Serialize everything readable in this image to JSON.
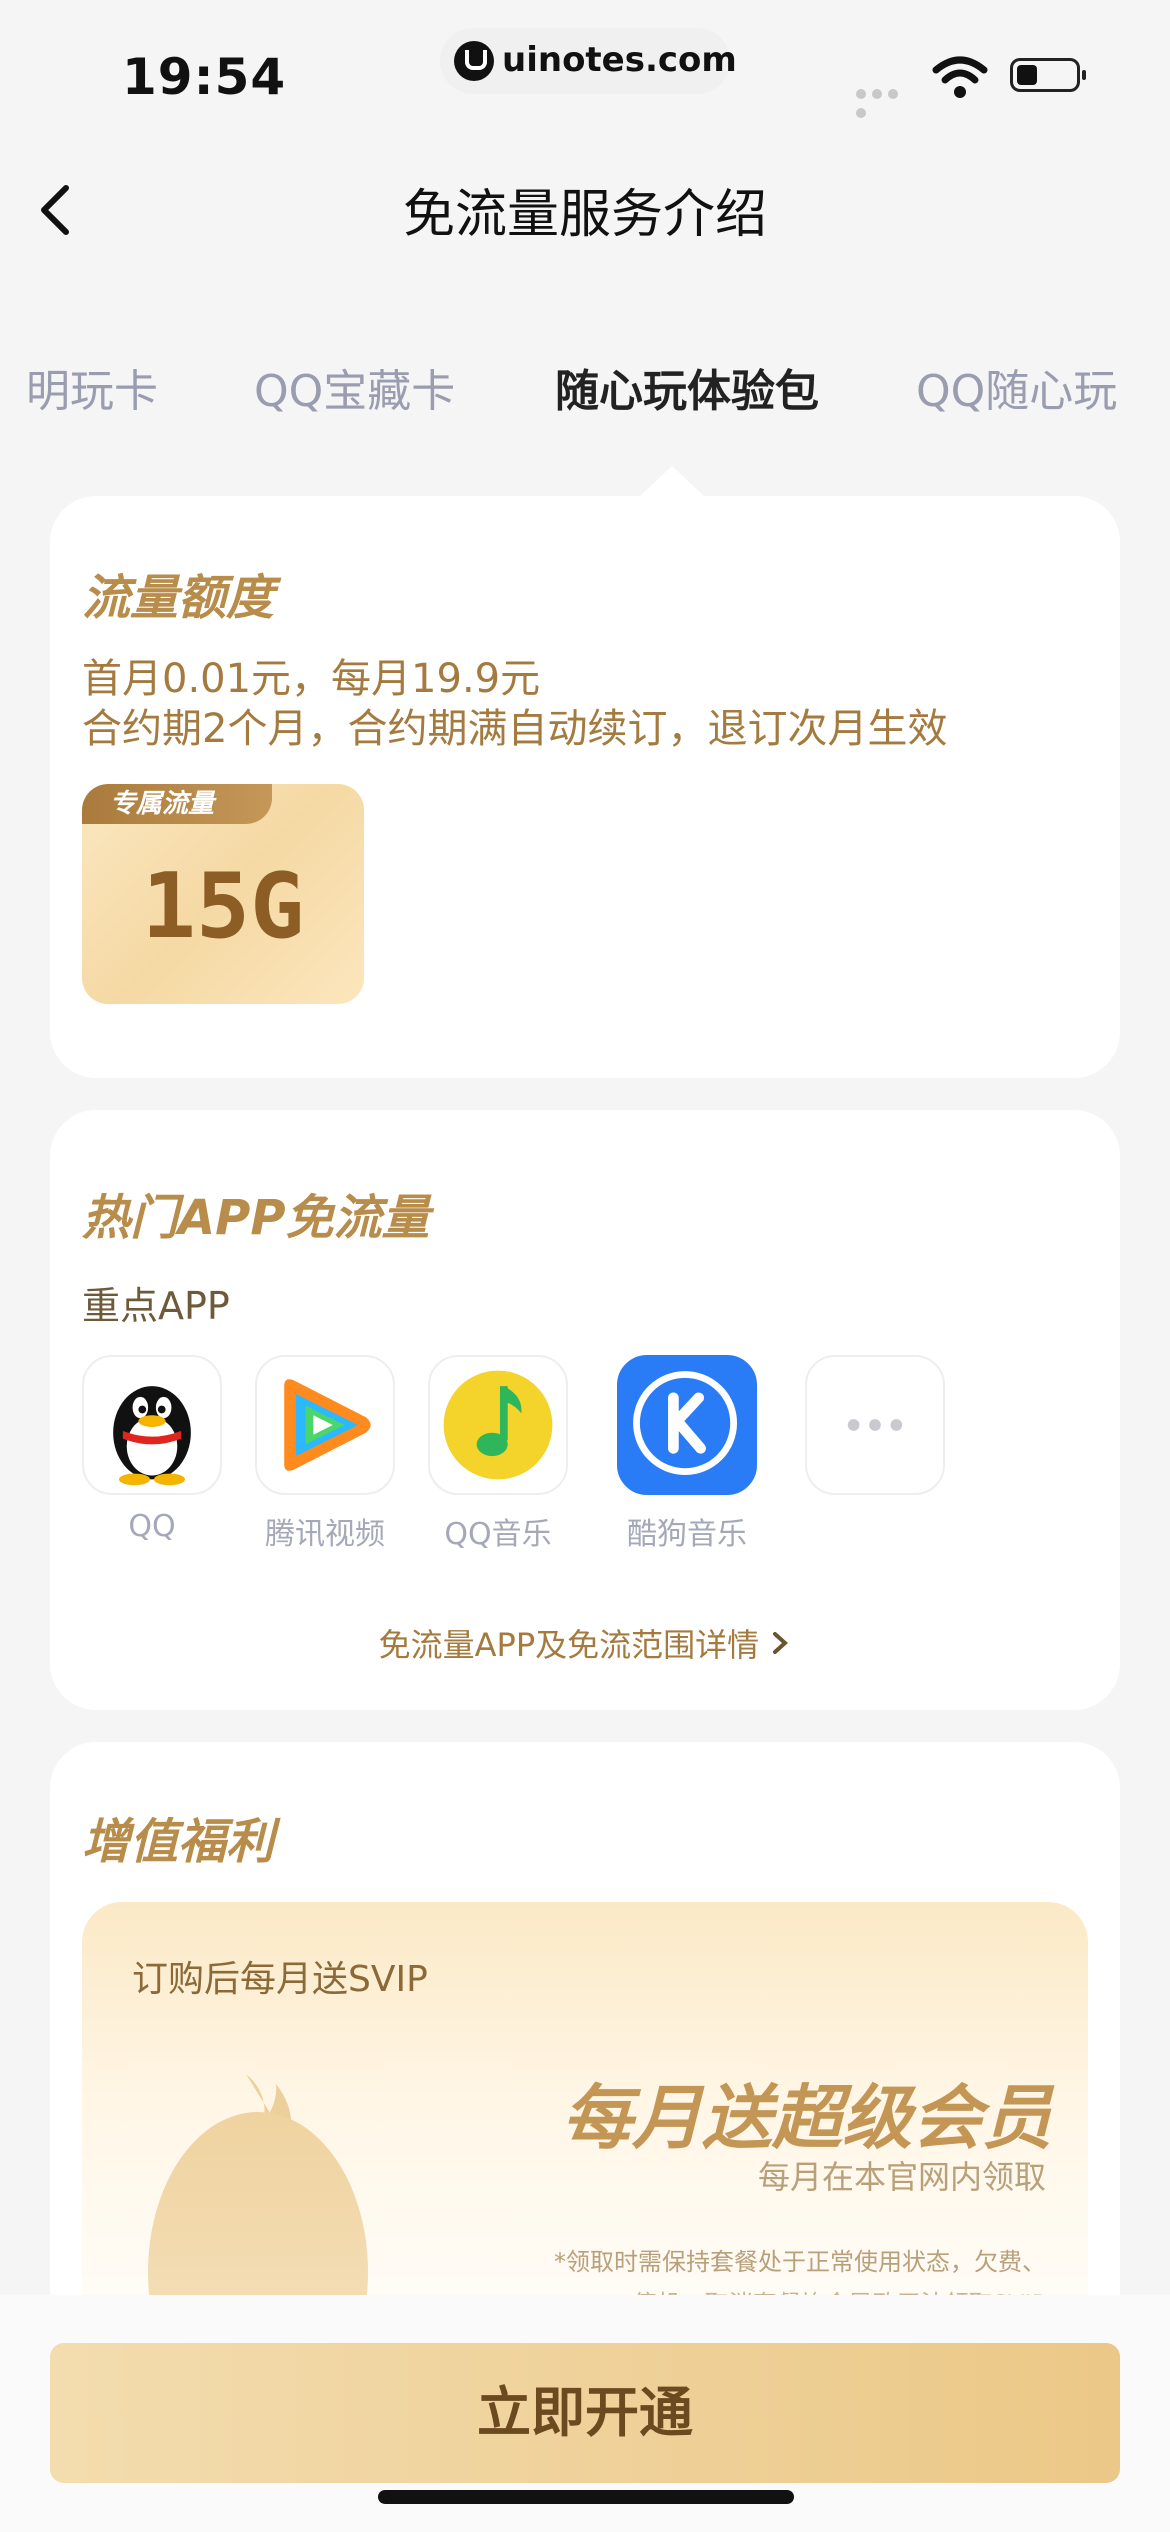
{
  "status_bar": {
    "time": "19:54",
    "url": "uinotes.com"
  },
  "header": {
    "title": "免流量服务介绍",
    "back_icon": "chevron-left-icon"
  },
  "tabs": [
    {
      "label": "明玩卡",
      "active": false
    },
    {
      "label": "QQ宝藏卡",
      "active": false
    },
    {
      "label": "随心玩体验包",
      "active": true
    },
    {
      "label": "QQ随心玩",
      "active": false
    }
  ],
  "quota": {
    "title": "流量额度",
    "line1": "首月0.01元，每月19.9元",
    "line2": "合约期2个月，合约期满自动续订，退订次月生效",
    "badge_label": "专属流量",
    "badge_amount": "15G"
  },
  "apps_section": {
    "title": "热门APP免流量",
    "subtitle": "重点APP",
    "apps": [
      {
        "name": "QQ",
        "icon": "qq-penguin-icon"
      },
      {
        "name": "腾讯视频",
        "icon": "tencent-video-icon"
      },
      {
        "name": "QQ音乐",
        "icon": "qq-music-icon"
      },
      {
        "name": "酷狗音乐",
        "icon": "kugou-music-icon"
      },
      {
        "name": "",
        "icon": "more-icon"
      }
    ],
    "detail_link": "免流量APP及免流范围详情"
  },
  "benefit": {
    "title": "增值福利",
    "subtitle": "订购后每月送SVIP",
    "headline": "每月送超级会员",
    "caption": "每月在本官网内领取",
    "note": "*领取时需保持套餐处于正常使用状态，欠费、",
    "note2": "停机、取消套餐均会导致无法领取SVIP"
  },
  "cta": {
    "label": "立即开通"
  },
  "colors": {
    "gold": "#b88c4a",
    "button_start": "#f3dcae",
    "button_end": "#ebc887"
  }
}
